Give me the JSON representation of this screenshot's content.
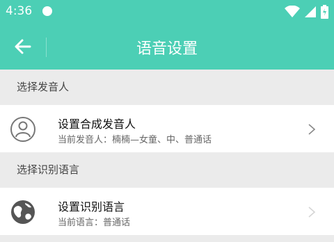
{
  "status_bar": {
    "time": "4:36"
  },
  "toolbar": {
    "title": "语音设置"
  },
  "sections": [
    {
      "header": "选择发音人",
      "item": {
        "title": "设置合成发音人",
        "subtitle": "当前发音人：楠楠—女童、中、普通话",
        "icon": "person-icon"
      }
    },
    {
      "header": "选择识别语言",
      "item": {
        "title": "设置识别语言",
        "subtitle": "当前语言：普通话",
        "icon": "globe-icon"
      }
    }
  ],
  "colors": {
    "accent": "#4ccfb5",
    "background": "#ebebeb"
  }
}
